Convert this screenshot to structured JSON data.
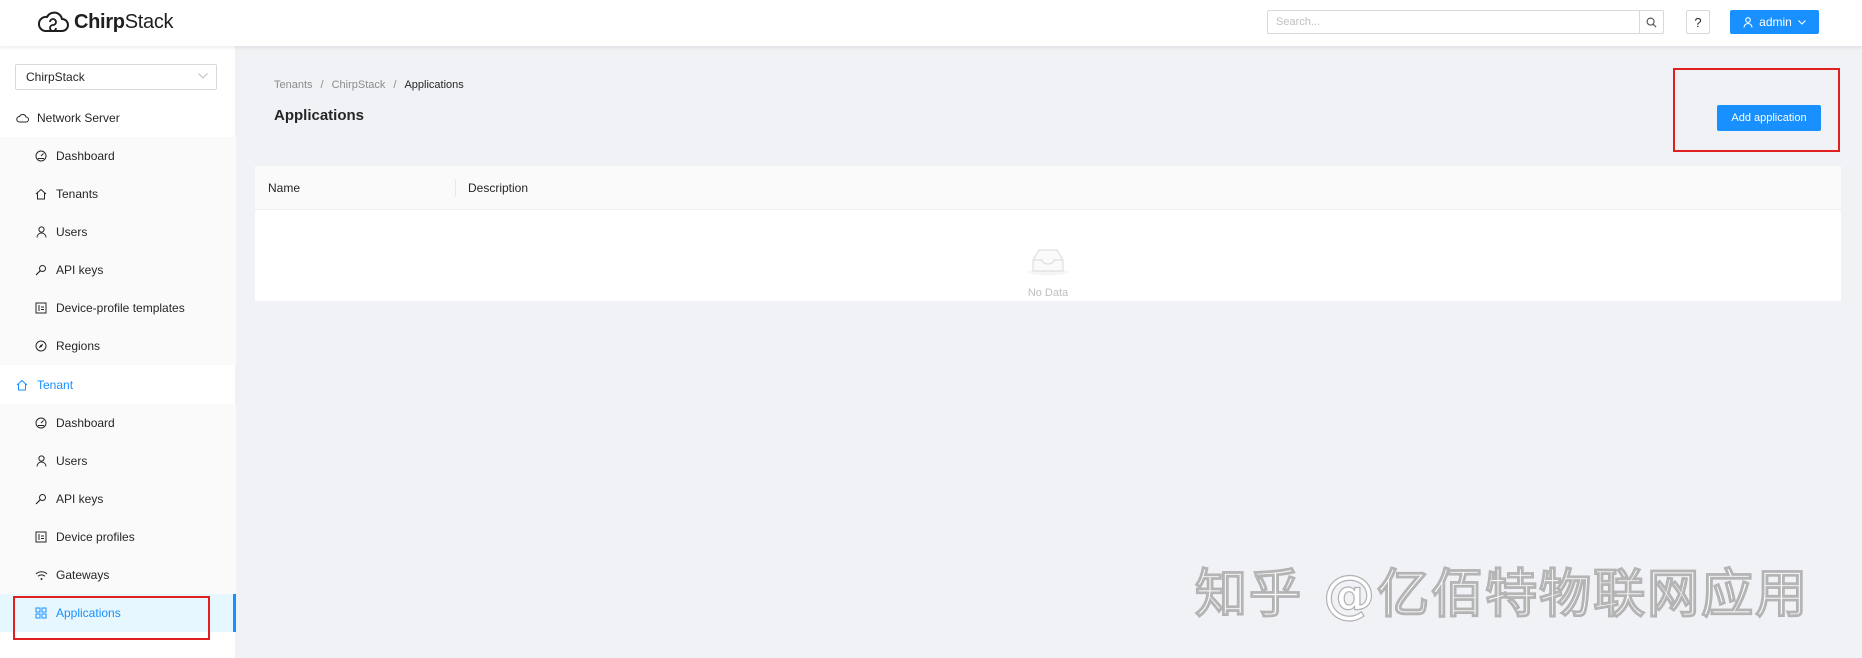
{
  "app": {
    "logo_text_bold": "Chirp",
    "logo_text_regular": "Stack"
  },
  "header": {
    "search_placeholder": "Search...",
    "help_label": "?",
    "user_label": "admin"
  },
  "sidebar": {
    "tenant_selected": "ChirpStack",
    "network_server": {
      "label": "Network Server",
      "items": [
        {
          "label": "Dashboard",
          "icon": "dashboard-icon"
        },
        {
          "label": "Tenants",
          "icon": "home-icon"
        },
        {
          "label": "Users",
          "icon": "user-icon"
        },
        {
          "label": "API keys",
          "icon": "key-icon"
        },
        {
          "label": "Device-profile templates",
          "icon": "template-icon"
        },
        {
          "label": "Regions",
          "icon": "compass-icon"
        }
      ]
    },
    "tenant": {
      "label": "Tenant",
      "items": [
        {
          "label": "Dashboard",
          "icon": "dashboard-icon"
        },
        {
          "label": "Users",
          "icon": "user-icon"
        },
        {
          "label": "API keys",
          "icon": "key-icon"
        },
        {
          "label": "Device profiles",
          "icon": "template-icon"
        },
        {
          "label": "Gateways",
          "icon": "wifi-icon"
        },
        {
          "label": "Applications",
          "icon": "appstore-icon",
          "selected": true
        }
      ]
    }
  },
  "main": {
    "breadcrumb": [
      "Tenants",
      "ChirpStack",
      "Applications"
    ],
    "title": "Applications",
    "add_button": "Add application",
    "table": {
      "columns": [
        "Name",
        "Description"
      ],
      "empty_text": "No Data"
    }
  },
  "watermark": "知乎 @亿佰特物联网应用",
  "colors": {
    "accent": "#1890ff",
    "highlight_box": "#e02020",
    "background": "#f0f2f5"
  }
}
